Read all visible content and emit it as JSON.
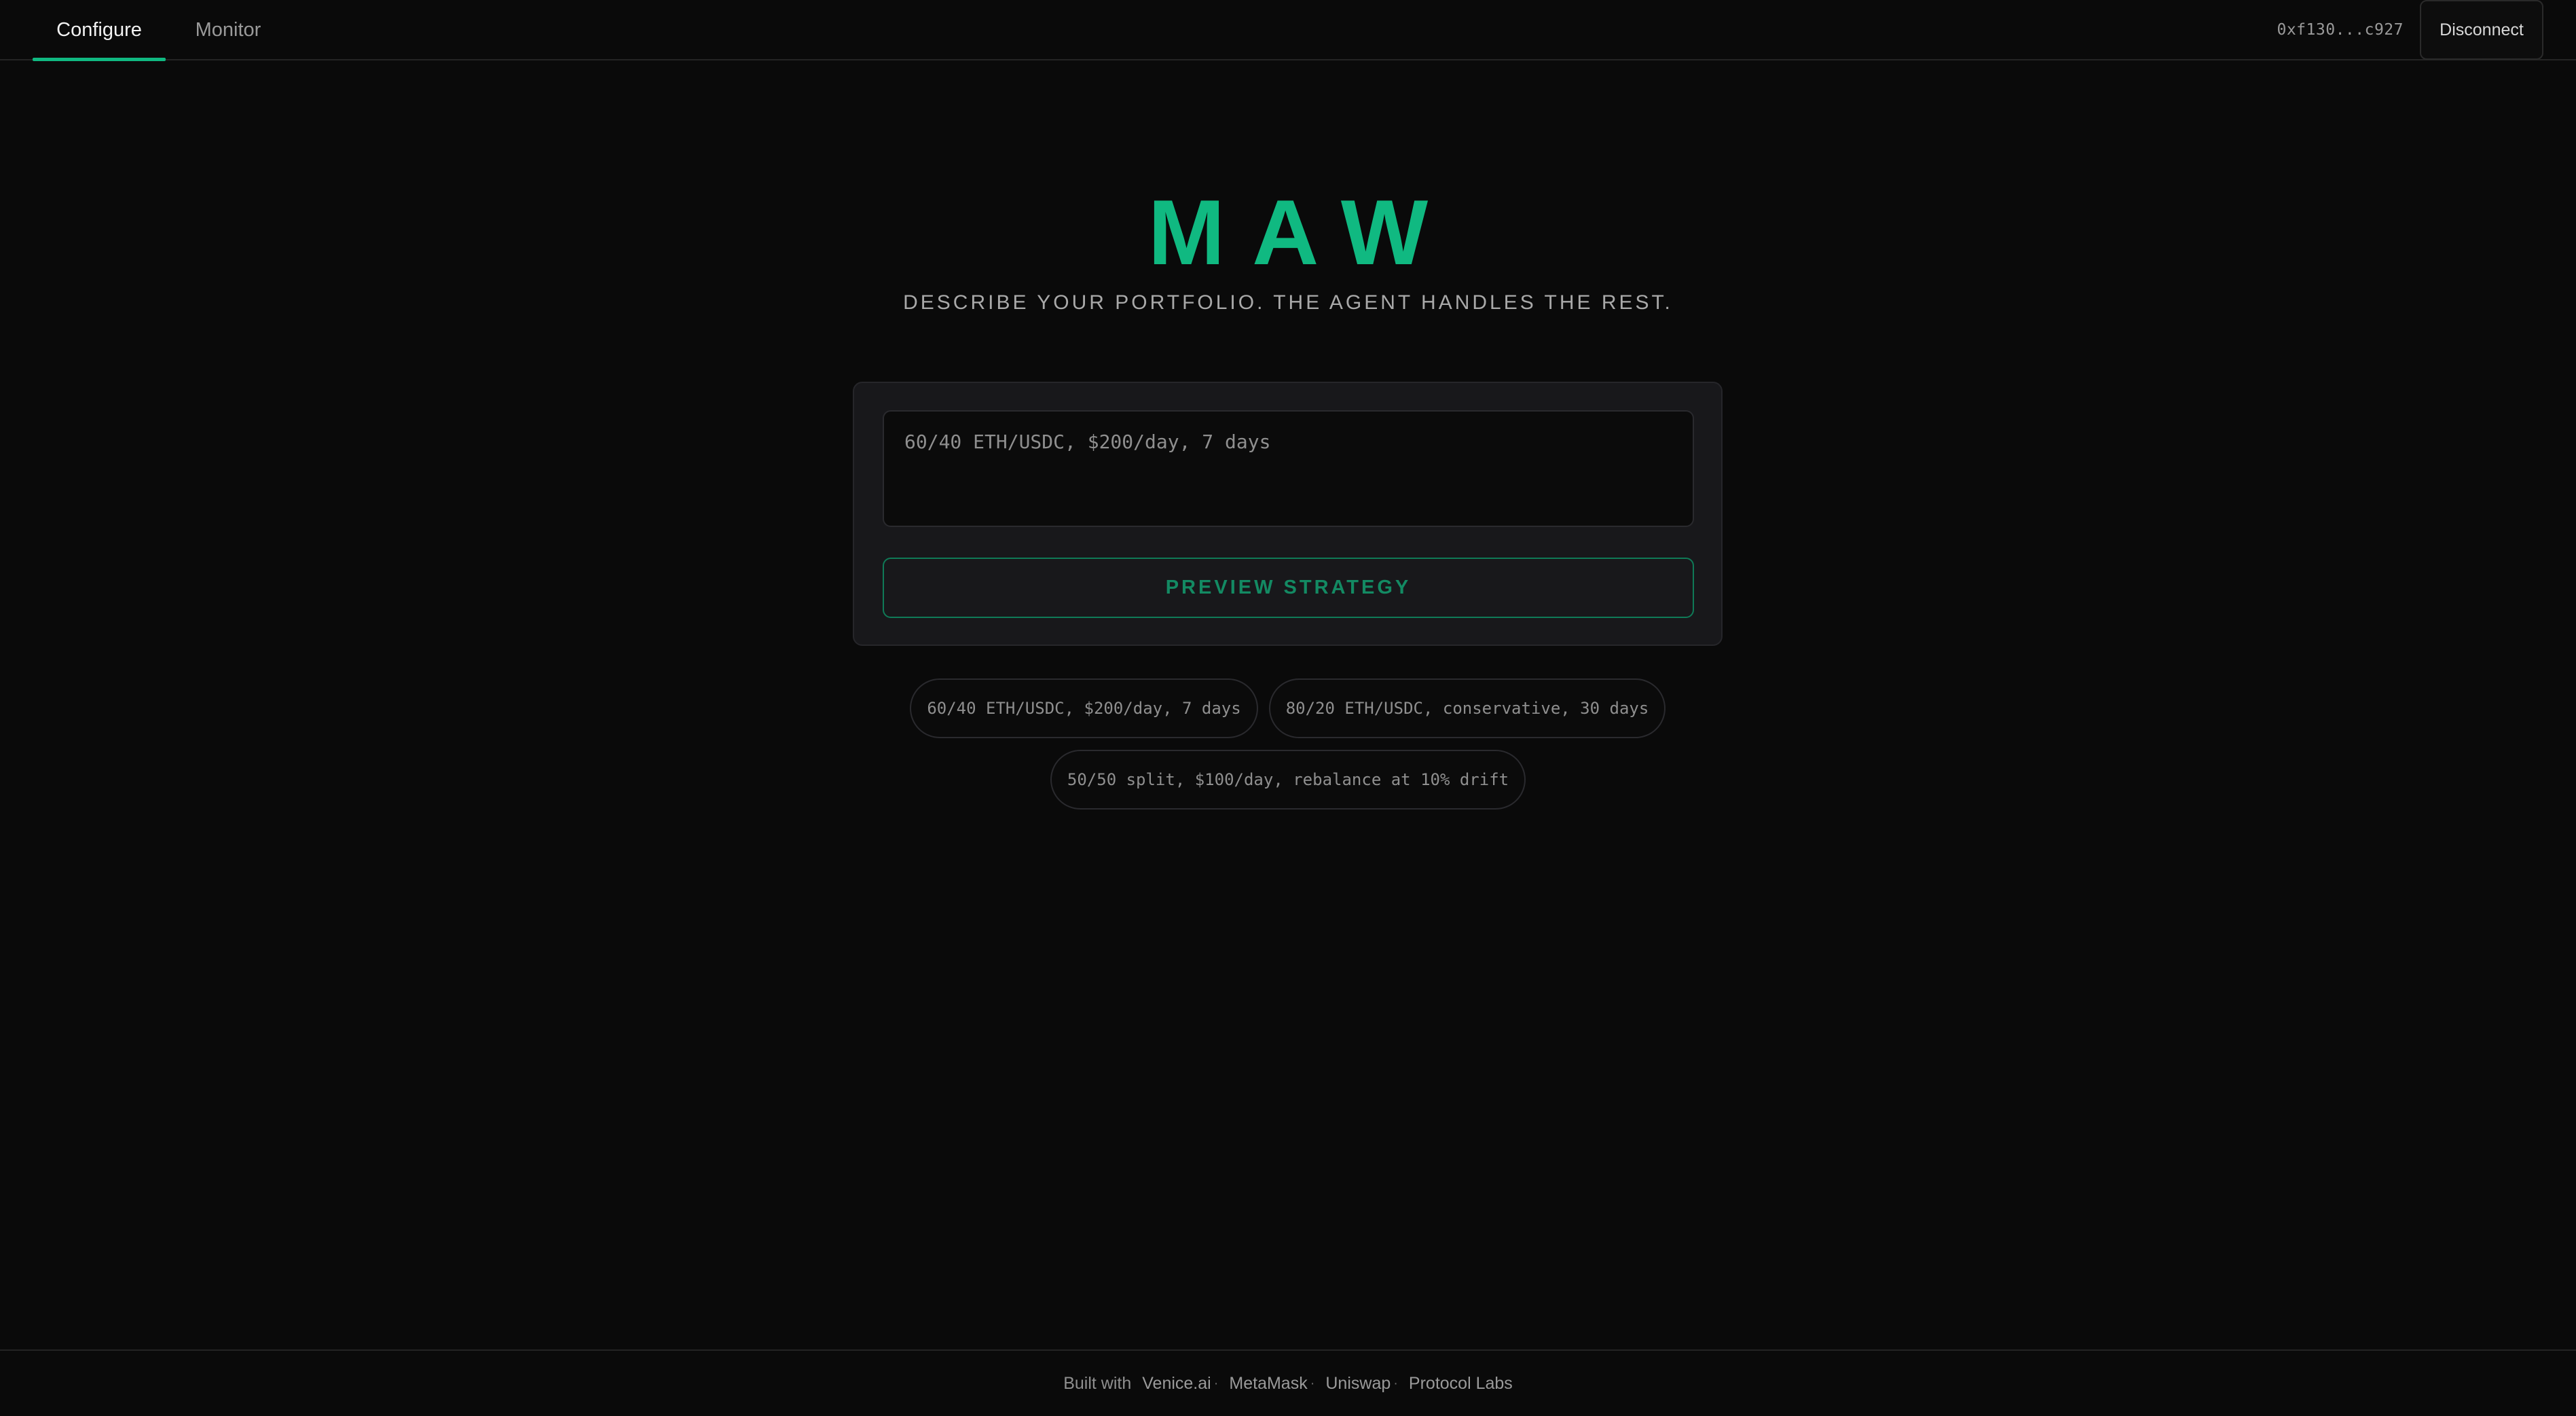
{
  "nav": {
    "tabs": [
      {
        "label": "Configure",
        "active": true
      },
      {
        "label": "Monitor",
        "active": false
      }
    ],
    "wallet_address": "0xf130...c927",
    "disconnect_label": "Disconnect"
  },
  "hero": {
    "logo": "MAW",
    "tagline": "DESCRIBE YOUR PORTFOLIO. THE AGENT HANDLES THE REST."
  },
  "composer": {
    "placeholder": "60/40 ETH/USDC, $200/day, 7 days",
    "value": "",
    "preview_label": "PREVIEW STRATEGY"
  },
  "suggestions": [
    "60/40 ETH/USDC, $200/day, 7 days",
    "80/20 ETH/USDC, conservative, 30 days",
    "50/50 split, $100/day, rebalance at 10% drift"
  ],
  "footer": {
    "built_with": "Built with",
    "links": [
      "Venice.ai",
      "MetaMask",
      "Uniswap",
      "Protocol Labs"
    ],
    "separator": "·"
  },
  "colors": {
    "background": "#0a0a0a",
    "accent": "#10b981",
    "panel": "#18181b"
  }
}
